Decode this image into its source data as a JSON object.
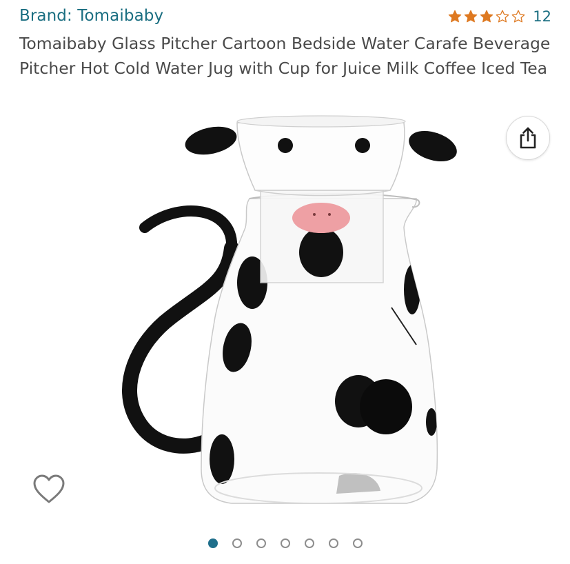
{
  "brand": {
    "label": "Brand: Tomaibaby"
  },
  "rating": {
    "value": 3,
    "max": 5,
    "count": "12",
    "star_color": "#de7921"
  },
  "product": {
    "title": "Tomaibaby Glass Pitcher Cartoon Bedside Water Carafe Beverage Pitcher Hot Cold Water Jug with Cup for Juice Milk Coffee Iced Tea",
    "image_subject": "cow-pattern-glass-pitcher-with-cup"
  },
  "actions": {
    "share_icon": "share-icon",
    "favorite_icon": "heart-outline-icon"
  },
  "carousel": {
    "total": 7,
    "active_index": 0,
    "active_color": "#1f6f8b"
  },
  "colors": {
    "link": "#1a6e81",
    "title_text": "#4a4a4a"
  }
}
